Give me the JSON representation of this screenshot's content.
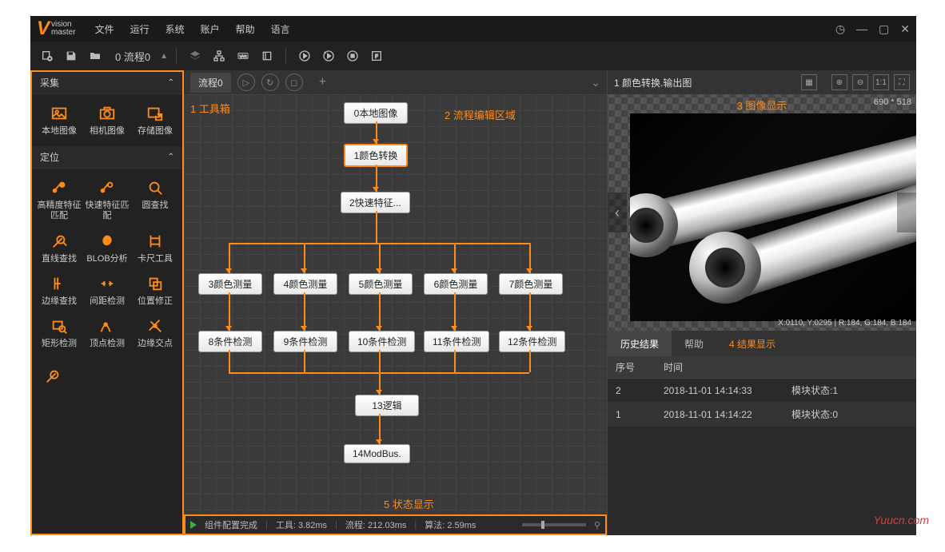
{
  "app": {
    "logo": "vision",
    "logo2": "master"
  },
  "menu": [
    "文件",
    "运行",
    "系统",
    "账户",
    "帮助",
    "语言"
  ],
  "toolbar": {
    "flow_name": "0 流程0"
  },
  "sidebar": {
    "panel1": {
      "title": "采集",
      "items": [
        {
          "label": "本地图像"
        },
        {
          "label": "相机图像"
        },
        {
          "label": "存储图像"
        }
      ]
    },
    "panel2": {
      "title": "定位",
      "items": [
        {
          "label": "高精度特征匹配"
        },
        {
          "label": "快速特征匹配"
        },
        {
          "label": "圆查找"
        },
        {
          "label": "直线查找"
        },
        {
          "label": "BLOB分析"
        },
        {
          "label": "卡尺工具"
        },
        {
          "label": "边缘查找"
        },
        {
          "label": "间距检测"
        },
        {
          "label": "位置修正"
        },
        {
          "label": "矩形检测"
        },
        {
          "label": "顶点检测"
        },
        {
          "label": "边缘交点"
        }
      ]
    }
  },
  "flow_tab": "流程0",
  "annotations": {
    "a1": "1 工具箱",
    "a2": "2 流程编辑区域",
    "a3": "3 图像显示",
    "a4": "4 结果显示",
    "a5": "5 状态显示"
  },
  "nodes": {
    "n0": "0本地图像",
    "n1": "1颜色转换",
    "n2": "2快速特征...",
    "n3": "3颜色测量",
    "n4": "4颜色测量",
    "n5": "5颜色测量",
    "n6": "6颜色测量",
    "n7": "7颜色测量",
    "n8": "8条件检测",
    "n9": "9条件检测",
    "n10": "10条件检测",
    "n11": "11条件检测",
    "n12": "12条件检测",
    "n13": "13逻辑",
    "n14": "14ModBus."
  },
  "status": {
    "cfg": "组件配置完成",
    "tool_label": "工具:",
    "tool_val": "3.82ms",
    "flow_label": "流程:",
    "flow_val": "212.03ms",
    "algo_label": "算法:",
    "algo_val": "2.59ms"
  },
  "image": {
    "title": "1 颜色转换.输出图",
    "dim": "690 * 518",
    "coords": "X:0110, Y:0295 | R:184, G:184, B:184"
  },
  "results": {
    "tabs": [
      "历史结果",
      "帮助"
    ],
    "head": [
      "序号",
      "时间",
      ""
    ],
    "rows": [
      {
        "idx": "2",
        "time": "2018-11-01 14:14:33",
        "msg": "模块状态:1"
      },
      {
        "idx": "1",
        "time": "2018-11-01 14:14:22",
        "msg": "模块状态:0"
      }
    ]
  },
  "watermark": "Yuucn.com"
}
